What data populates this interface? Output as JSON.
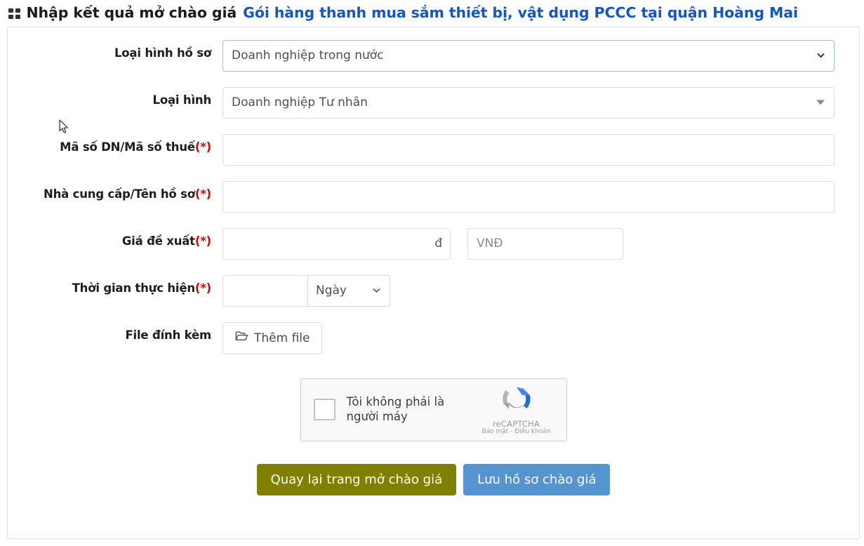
{
  "header": {
    "icon": "grid-icon",
    "title_main": "Nhập kết quả mở chào giá",
    "title_accent": "Gói hàng thanh mua sắm thiết bị, vật dụng PCCC tại quận Hoàng Mai",
    "accent_color": "#1456c8"
  },
  "form": {
    "doc_type": {
      "label": "Loại hình hồ sơ",
      "value": "Doanh nghiệp trong nước",
      "options": [
        "Doanh nghiệp trong nước"
      ],
      "icon": "chevron-down-icon",
      "border_color": "#9fc0cd"
    },
    "business_type": {
      "label": "Loại hình",
      "value": "Doanh nghiệp Tư nhân",
      "options": [
        "Doanh nghiệp Tư nhân"
      ],
      "icon": "triangle-down-icon",
      "border_color": "#dcdcdc"
    },
    "tax_code": {
      "label": "Mã số DN/Mã số thuế",
      "required_mark": "(*)",
      "value": "",
      "placeholder": ""
    },
    "supplier": {
      "label": "Nhà cung cấp/Tên hồ sơ",
      "required_mark": "(*)",
      "value": "",
      "placeholder": ""
    },
    "price": {
      "label": "Giá đề xuất",
      "required_mark": "(*)",
      "value": "",
      "placeholder": "",
      "suffix": "đ",
      "currency_value": "",
      "currency_placeholder": "VNĐ"
    },
    "duration": {
      "label": "Thời gian thực hiện",
      "required_mark": "(*)",
      "value": "",
      "placeholder": "",
      "unit_value": "Ngày",
      "unit_options": [
        "Ngày"
      ],
      "icon": "chevron-down-icon"
    },
    "attachment": {
      "label": "File đính kèm",
      "button_label": "Thêm file",
      "icon": "folder-open-icon"
    }
  },
  "captcha": {
    "checkbox_label": "Tôi không phải là người máy",
    "brand": "reCAPTCHA",
    "terms": "Bảo mật - Điều khoản",
    "icon": "recaptcha-logo-icon"
  },
  "actions": {
    "back_label": "Quay lại trang mở chào giá",
    "back_color": "#808000",
    "save_label": "Lưu hồ sơ chào giá",
    "save_color": "#5494d1"
  }
}
